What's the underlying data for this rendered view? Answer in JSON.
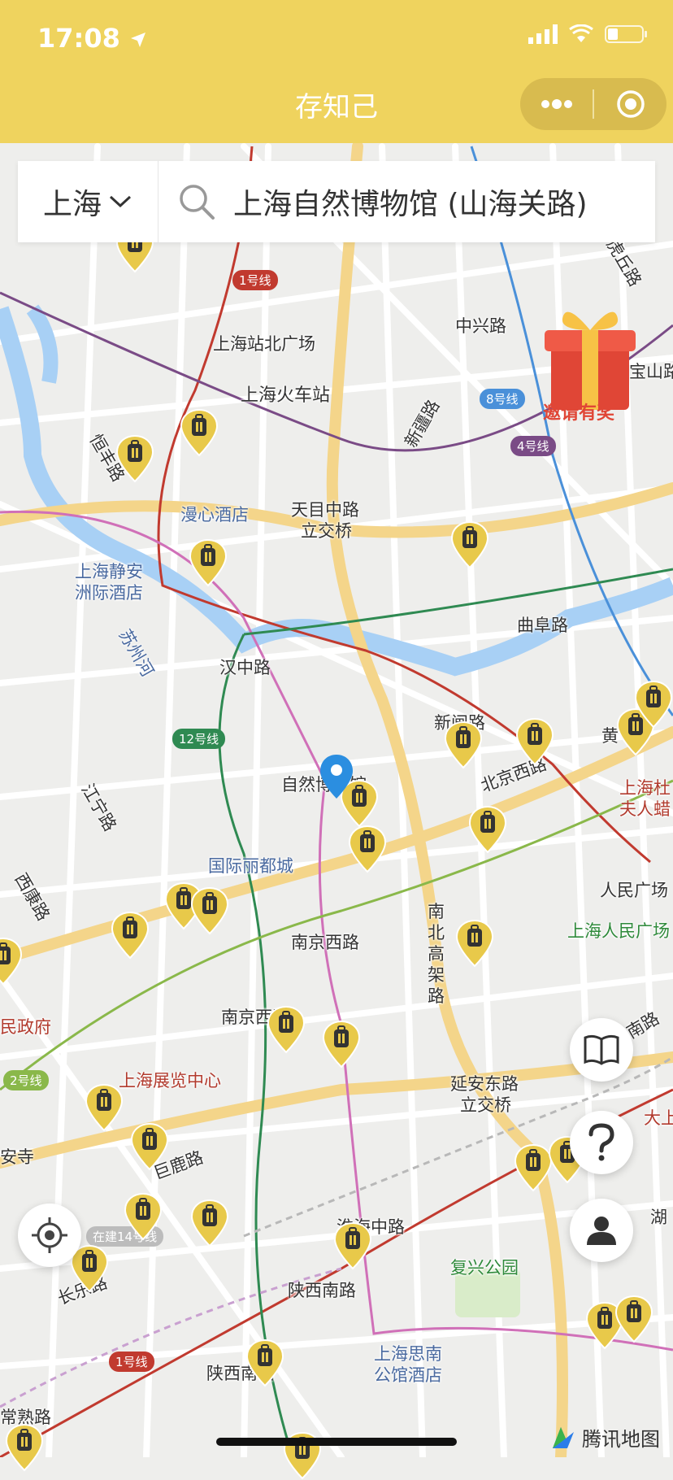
{
  "status_bar": {
    "time": "17:08"
  },
  "header": {
    "title": "存知己"
  },
  "search": {
    "city": "上海",
    "query": "上海自然博物馆 (山海关路)"
  },
  "promo": {
    "label": "邀请有奖"
  },
  "map_labels": [
    "上海站北广场",
    "上海火车站",
    "中兴路",
    "宝山路",
    "天目中路",
    "立交桥",
    "漫心酒店",
    "上海静安",
    "洲际酒店",
    "曲阜路",
    "汉中路",
    "苏州河",
    "新闸路",
    "北京西路",
    "黄",
    "上海杜",
    "夫人蜡",
    "自然博物馆",
    "国际丽都城",
    "人民广场",
    "上海人民广场",
    "南京西路",
    "南北高架路",
    "南京西路",
    "上海展览中心",
    "巨鹿路",
    "延安东路",
    "立交桥",
    "淮海中路",
    "复兴公园",
    "陕西南路",
    "上海思南",
    "公馆酒店",
    "陕西南路",
    "常熟路",
    "江宁路",
    "西康路",
    "民政府",
    "安寺",
    "长乐路",
    "恒丰路",
    "新疆路",
    "湖",
    "大上",
    "南路",
    "虎丘路"
  ],
  "line_badges": [
    "1号线",
    "8号线",
    "4号线",
    "12号线",
    "2号线",
    "在建14号线",
    "1号线"
  ],
  "colors": {
    "header": "#efd35e",
    "marker": "#e8c94a",
    "pin": "#2b8ee0"
  },
  "icons": [
    "location-arrow-icon",
    "signal-icon",
    "wifi-icon",
    "battery-icon",
    "more-icon",
    "target-icon",
    "search-icon",
    "chevron-down-icon",
    "book-icon",
    "help-icon",
    "user-icon",
    "locate-icon",
    "gift-icon",
    "tencent-map-logo-icon"
  ],
  "watermark": {
    "text": "腾讯地图"
  }
}
